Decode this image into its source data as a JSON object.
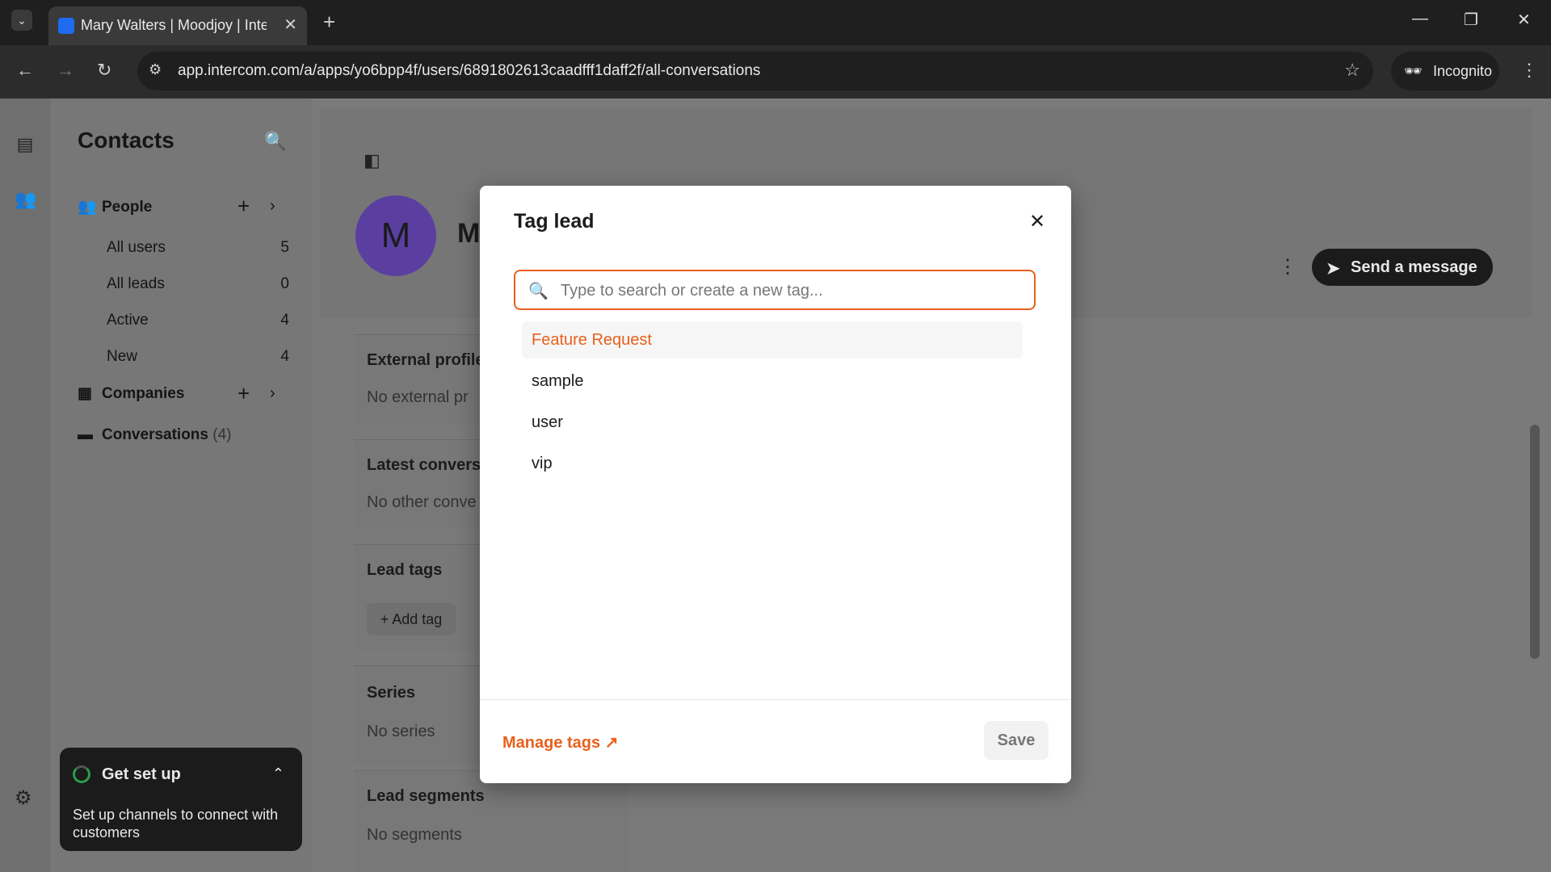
{
  "browser": {
    "tab_title": "Mary Walters | Moodjoy | Interc",
    "url": "app.intercom.com/a/apps/yo6bpp4f/users/6891802613caadfff1daff2f/all-conversations",
    "incognito_label": "Incognito"
  },
  "sidebar": {
    "title": "Contacts",
    "people_label": "People",
    "items": [
      {
        "label": "All users",
        "count": "5"
      },
      {
        "label": "All leads",
        "count": "0"
      },
      {
        "label": "Active",
        "count": "4"
      },
      {
        "label": "New",
        "count": "4"
      }
    ],
    "companies_label": "Companies",
    "conversations_label": "Conversations",
    "conversations_count": "(4)"
  },
  "setup": {
    "title": "Get set up",
    "description": "Set up channels to connect with customers"
  },
  "profile": {
    "avatar_letter": "M",
    "name_initial": "M",
    "send_message_label": "Send a message"
  },
  "cards": {
    "external_profiles": {
      "header": "External profile",
      "value": "No external pr"
    },
    "latest_conversations": {
      "header": "Latest convers",
      "value": "No other conve"
    },
    "lead_tags": {
      "header": "Lead tags",
      "add_label": "+ Add tag"
    },
    "series": {
      "header": "Series",
      "value": "No series"
    },
    "lead_segments": {
      "header": "Lead segments",
      "value": "No segments"
    }
  },
  "modal": {
    "title": "Tag lead",
    "search_placeholder": "Type to search or create a new tag...",
    "tags": [
      "Feature Request",
      "sample",
      "user",
      "vip"
    ],
    "manage_tags_label": "Manage tags ↗",
    "save_label": "Save"
  },
  "colors": {
    "accent": "#e8601c",
    "avatar": "#5a3fa1"
  }
}
